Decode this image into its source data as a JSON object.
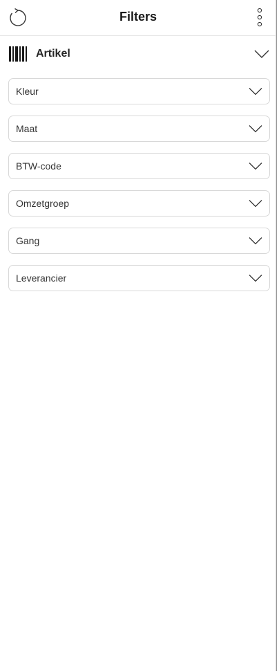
{
  "header": {
    "title": "Filters",
    "refresh_icon": "refresh-icon",
    "more_icon": "more-vertical-icon"
  },
  "section": {
    "label": "Artikel",
    "icon": "barcode-icon",
    "expanded": true
  },
  "filters": [
    {
      "label": "Kleur"
    },
    {
      "label": "Maat"
    },
    {
      "label": "BTW-code"
    },
    {
      "label": "Omzetgroep"
    },
    {
      "label": "Gang"
    },
    {
      "label": "Leverancier"
    }
  ]
}
